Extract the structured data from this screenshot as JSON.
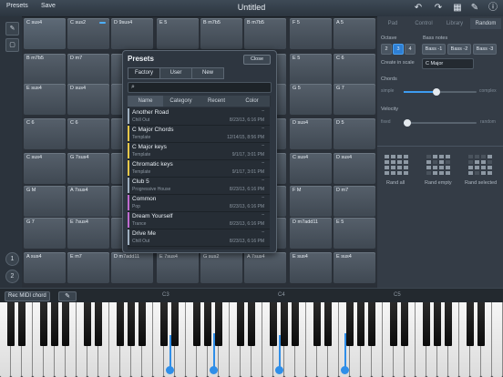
{
  "topbar": {
    "presets_label": "Presets",
    "save_label": "Save",
    "title": "Untitled"
  },
  "left_buttons": {
    "btn1": "1",
    "btn2": "2"
  },
  "pads": [
    [
      "C sus4",
      "C sus2",
      "D 9sus4",
      "E 5",
      "B m7b5",
      "B m7b5",
      "F 5",
      "A 5"
    ],
    [
      "B m7b5",
      "D m7",
      "",
      "",
      "",
      "",
      "E 5",
      "C 6"
    ],
    [
      "E sus4",
      "D sus4",
      "",
      "",
      "",
      "",
      "G 5",
      "G 7"
    ],
    [
      "C 6",
      "C 6",
      "",
      "",
      "",
      "",
      "D sus4",
      "D 5"
    ],
    [
      "C sus4",
      "G 7sus4",
      "",
      "",
      "",
      "",
      "C sus4",
      "D sus4"
    ],
    [
      "G M",
      "A 7sus4",
      "",
      "",
      "",
      "",
      "F M",
      "D m7"
    ],
    [
      "G 7",
      "E 7sus4",
      "",
      "",
      "",
      "",
      "D m7add11",
      "E 5"
    ],
    [
      "A sus4",
      "E m7",
      "D m7add11",
      "E 7sus4",
      "G sus2",
      "A 7sus4",
      "E sus4",
      "E sus4"
    ]
  ],
  "right_panel": {
    "tabs": [
      "Pad",
      "Control",
      "Library",
      "Random"
    ],
    "selected_tab": "Random",
    "octave_label": "Octave",
    "octave_options": [
      "2",
      "3",
      "4"
    ],
    "octave_selected": "3",
    "bass_label": "Bass notes",
    "bass_options": [
      "Bass -1",
      "Bass -2",
      "Bass -3"
    ],
    "scale_label": "Create in scale",
    "scale_value": "C Major",
    "chords_label": "Chords",
    "chords_min": "simple",
    "chords_max": "complex",
    "chords_level": 0.45,
    "velocity_label": "Velocity",
    "velocity_min": "fixed",
    "velocity_max": "random",
    "velocity_level": 0.05,
    "rand_buttons": [
      "Rand all",
      "Rand empty",
      "Rand selected"
    ]
  },
  "keybar": {
    "rec_label": "Rec MIDI chord",
    "c3": "C3",
    "c4": "C4",
    "c5": "C5"
  },
  "popup": {
    "title": "Presets",
    "close_label": "Close",
    "segments": [
      "Factory",
      "User",
      "New"
    ],
    "selected_segment": "Factory",
    "columns": [
      "Name",
      "Category",
      "Recent",
      "Color"
    ],
    "selected_column": "Name",
    "rows": [
      {
        "name": "Another Road",
        "category": "Chill Out",
        "date": "8/23/13, 6:16 PM",
        "color": "#9fb0c0"
      },
      {
        "name": "C Major Chords",
        "category": "Template",
        "date": "12/14/15, 8:56 PM",
        "color": "#e8c84a"
      },
      {
        "name": "C Major keys",
        "category": "Template",
        "date": "9/1/17, 3:01 PM",
        "color": "#e8c84a"
      },
      {
        "name": "Chromatic keys",
        "category": "Template",
        "date": "9/1/17, 3:01 PM",
        "color": "#e8c84a"
      },
      {
        "name": "Club 5",
        "category": "Progressive House",
        "date": "8/23/13, 6:16 PM",
        "color": "#9fb0c0"
      },
      {
        "name": "Common",
        "category": "Pop",
        "date": "8/23/13, 6:16 PM",
        "color": "#c06bd0"
      },
      {
        "name": "Dream Yourself",
        "category": "Trance",
        "date": "8/23/13, 6:16 PM",
        "color": "#c06bd0"
      },
      {
        "name": "Drive Me",
        "category": "Chill Out",
        "date": "8/23/13, 6:16 PM",
        "color": "#9fb0c0"
      }
    ]
  },
  "colors": {
    "accent": "#2f8ee8"
  }
}
